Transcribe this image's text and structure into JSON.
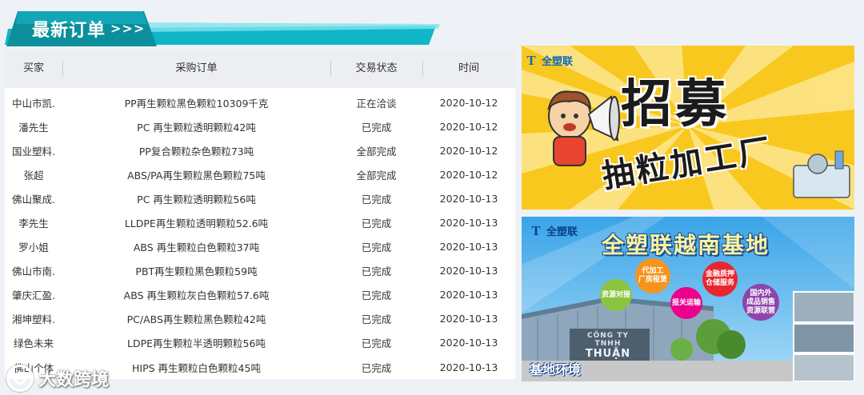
{
  "section": {
    "title": "最新订单",
    "arrows": ">>>"
  },
  "table": {
    "headers": [
      "买家",
      "采购订单",
      "交易状态",
      "时间"
    ],
    "rows": [
      {
        "buyer": "中山市凯.",
        "item": "PP再生颗粒黑色颗粒10309千克",
        "status": "正在洽谈",
        "date": "2020-10-12"
      },
      {
        "buyer": "潘先生",
        "item": "PC 再生颗粒透明颗粒42吨",
        "status": "已完成",
        "date": "2020-10-12"
      },
      {
        "buyer": "国业塑料.",
        "item": "PP复合颗粒杂色颗粒73吨",
        "status": "全部完成",
        "date": "2020-10-12"
      },
      {
        "buyer": "张超",
        "item": "ABS/PA再生颗粒黑色颗粒75吨",
        "status": "全部完成",
        "date": "2020-10-12"
      },
      {
        "buyer": "佛山聚成.",
        "item": "PC 再生颗粒透明颗粒56吨",
        "status": "已完成",
        "date": "2020-10-13"
      },
      {
        "buyer": "李先生",
        "item": "LLDPE再生颗粒透明颗粒52.6吨",
        "status": "已完成",
        "date": "2020-10-13"
      },
      {
        "buyer": "罗小姐",
        "item": "ABS 再生颗粒白色颗粒37吨",
        "status": "已完成",
        "date": "2020-10-13"
      },
      {
        "buyer": "佛山市南.",
        "item": "PBT再生颗粒黑色颗粒59吨",
        "status": "已完成",
        "date": "2020-10-13"
      },
      {
        "buyer": "肇庆汇盈.",
        "item": "ABS 再生颗粒灰白色颗粒57.6吨",
        "status": "已完成",
        "date": "2020-10-13"
      },
      {
        "buyer": "湘坤塑料.",
        "item": "PC/ABS再生颗粒黑色颗粒42吨",
        "status": "已完成",
        "date": "2020-10-13"
      },
      {
        "buyer": "绿色未来",
        "item": "LDPE再生颗粒半透明颗粒56吨",
        "status": "已完成",
        "date": "2020-10-13"
      },
      {
        "buyer": "佛山个体",
        "item": "HIPS 再生颗粒白色颗粒45吨",
        "status": "已完成",
        "date": "2020-10-13"
      }
    ]
  },
  "banner_recruit": {
    "logo_mark": "T",
    "logo_text": "全塑联",
    "title": "招募",
    "subtitle": "抽粒加工厂"
  },
  "banner_vietnam": {
    "logo_mark": "T",
    "logo_text": "全塑联",
    "title": "全塑联越南基地",
    "bubbles": [
      {
        "text": "资源对接",
        "color": "#8bc53f"
      },
      {
        "text": "代加工\n厂房租赁",
        "color": "#f7941d"
      },
      {
        "text": "报关运输",
        "color": "#ec008c"
      },
      {
        "text": "金融质押\n仓储服务",
        "color": "#e8262d"
      },
      {
        "text": "国内外\n成品销售\n资源联营",
        "color": "#8e44ad"
      }
    ],
    "sign_small": "CÔNG TY TNHH",
    "sign_big": "THUẬN",
    "caption": "基地环境"
  },
  "watermark": "大数跨境",
  "colors": {
    "ribbon_dark": "#0c8f9c",
    "ribbon_light": "#27c6d8",
    "header_bg": "#eceef1"
  }
}
